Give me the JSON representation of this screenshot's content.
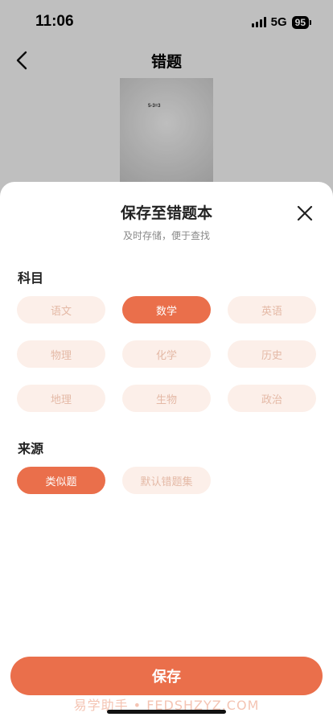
{
  "status_bar": {
    "time": "11:06",
    "network": "5G",
    "battery": "95"
  },
  "nav": {
    "title": "错题",
    "back_icon": "chevron-left-icon"
  },
  "photo": {
    "content_text": "5-3=3"
  },
  "sheet": {
    "title": "保存至错题本",
    "subtitle": "及时存储，便于查找",
    "close_icon": "close-icon"
  },
  "subject": {
    "label": "科目",
    "options": [
      "语文",
      "数学",
      "英语",
      "物理",
      "化学",
      "历史",
      "地理",
      "生物",
      "政治"
    ],
    "selected": "数学"
  },
  "source": {
    "label": "来源",
    "options": [
      "类似题",
      "默认错题集"
    ],
    "selected": "类似题"
  },
  "actions": {
    "save_label": "保存"
  },
  "watermark": "易学助手 • FEDSHZYZ.COM",
  "colors": {
    "accent": "#ea6f4b",
    "chip_bg": "#fcefe9",
    "chip_text": "#e4b9a6"
  }
}
